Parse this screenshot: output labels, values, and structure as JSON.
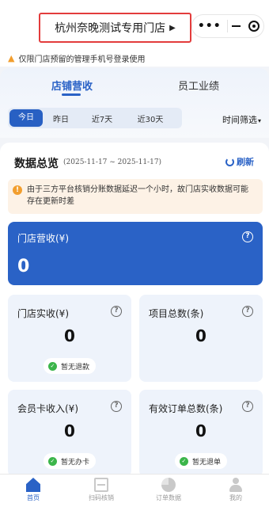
{
  "header": {
    "store_name": "杭州奈晚测试专用门店",
    "store_arrow": "▶"
  },
  "capsule": {
    "more": "•••"
  },
  "notice": {
    "text": "仅限门店预留的管理手机号登录使用"
  },
  "main_tabs": [
    {
      "label": "店铺营收",
      "active": true
    },
    {
      "label": "员工业绩",
      "active": false
    }
  ],
  "date_filters": [
    {
      "label": "今日",
      "active": true
    },
    {
      "label": "昨日",
      "active": false
    },
    {
      "label": "近7天",
      "active": false
    },
    {
      "label": "近30天",
      "active": false
    }
  ],
  "time_filter": {
    "label": "时间筛选",
    "caret": "▾"
  },
  "overview": {
    "title": "数据总览",
    "range": "(2025-11-17 ~ 2025-11-17)",
    "refresh_label": "刷新",
    "warning": "由于三方平台核销分账数据延迟一个小时，故门店实收数据可能存在更新时差"
  },
  "revenue": {
    "label": "门店营收(¥)",
    "value": "0"
  },
  "stats": {
    "actual": {
      "label": "门店实收(¥)",
      "value": "0",
      "badge": "暂无退款"
    },
    "items": {
      "label": "项目总数(条)",
      "value": "0"
    },
    "member": {
      "label": "会员卡收入(¥)",
      "value": "0",
      "badge": "暂无办卡"
    },
    "orders": {
      "label": "有效订单总数(条)",
      "value": "0",
      "badge": "暂无退单"
    }
  },
  "help_glyph": "?",
  "check_glyph": "✓",
  "warn_glyph": "!",
  "bottom_nav": [
    {
      "label": "首页",
      "icon": "home-icon",
      "active": true
    },
    {
      "label": "扫码核销",
      "icon": "scan-icon",
      "active": false
    },
    {
      "label": "订单数据",
      "icon": "pie-chart-icon",
      "active": false
    },
    {
      "label": "我的",
      "icon": "user-icon",
      "active": false
    }
  ],
  "colors": {
    "accent": "#2a62c6",
    "warning_bg": "#fdf2e6",
    "success": "#3bb54a",
    "highlight_border": "#e33c3c"
  }
}
